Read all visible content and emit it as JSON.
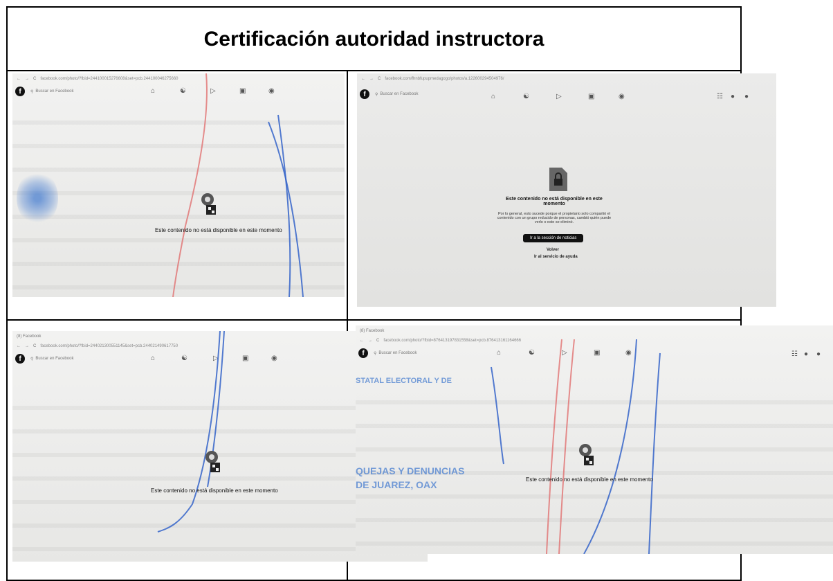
{
  "document": {
    "title": "Certificación autoridad instructora"
  },
  "shots": [
    {
      "url": "facebook.com/photo/?fbid=244100015276608&set=pcb.244100046275660",
      "search_placeholder": "Buscar en Facebook",
      "message": "Este contenido no está disponible en este momento"
    },
    {
      "tab": "",
      "url": "facebook.com/fhnbfupupmedagogo/photos/a.122600294504976/",
      "search_placeholder": "Buscar en Facebook",
      "heading": "Este contenido no está disponible en este momento",
      "body": "Por lo general, esto sucede porque el propietario solo compartió el contenido con un grupo reducido de personas, cambió quién puede verlo o este se eliminó.",
      "button": "Ir a la sección de noticias",
      "back": "Volver",
      "help": "Ir al servicio de ayuda"
    },
    {
      "tab": "(8) Facebook",
      "url": "facebook.com/photo/?fbid=244021300551145&set=pcb.244021490617750",
      "search_placeholder": "Buscar en Facebook",
      "message": "Este contenido no está disponible en este momento"
    },
    {
      "tab": "(8) Facebook",
      "url": "facebook.com/photo/?fbid=876413197831558&set=pcb.876413161164666",
      "search_placeholder": "Buscar en Facebook",
      "message": "Este contenido no está disponible en este momento",
      "stamp_lines": [
        "STATAL ELECTORAL Y DE",
        "QUEJAS Y DENUNCIAS",
        "DE JUAREZ, OAX"
      ]
    }
  ]
}
